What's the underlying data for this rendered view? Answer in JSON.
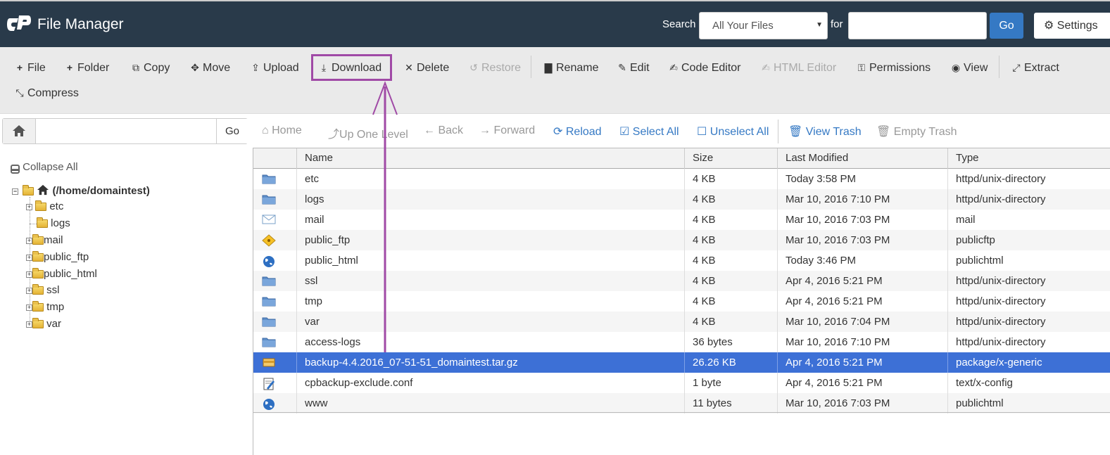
{
  "header": {
    "app_title": "File Manager",
    "search_label": "Search",
    "search_scope": "All Your Files",
    "for_label": "for",
    "search_value": "",
    "go_label": "Go",
    "settings_label": "Settings"
  },
  "toolbar": {
    "file": "File",
    "folder": "Folder",
    "copy": "Copy",
    "move": "Move",
    "upload": "Upload",
    "download": "Download",
    "delete": "Delete",
    "restore": "Restore",
    "rename": "Rename",
    "edit": "Edit",
    "code_editor": "Code Editor",
    "html_editor": "HTML Editor",
    "permissions": "Permissions",
    "view": "View",
    "extract": "Extract",
    "compress": "Compress"
  },
  "left": {
    "path_value": "",
    "go_label": "Go",
    "collapse_all": "Collapse All",
    "root": "(/home/domaintest)",
    "tree": [
      "etc",
      "logs",
      "mail",
      "public_ftp",
      "public_html",
      "ssl",
      "tmp",
      "var"
    ]
  },
  "navbar": {
    "home": "Home",
    "up_one_level": "Up One Level",
    "back": "Back",
    "forward": "Forward",
    "reload": "Reload",
    "select_all": "Select All",
    "unselect_all": "Unselect All",
    "view_trash": "View Trash",
    "empty_trash": "Empty Trash"
  },
  "table": {
    "columns": [
      "Name",
      "Size",
      "Last Modified",
      "Type"
    ],
    "rows": [
      {
        "icon": "folder-icon",
        "name": "etc",
        "size": "4 KB",
        "modified": "Today 3:58 PM",
        "type": "httpd/unix-directory"
      },
      {
        "icon": "folder-icon",
        "name": "logs",
        "size": "4 KB",
        "modified": "Mar 10, 2016 7:10 PM",
        "type": "httpd/unix-directory"
      },
      {
        "icon": "mail-icon",
        "name": "mail",
        "size": "4 KB",
        "modified": "Mar 10, 2016 7:03 PM",
        "type": "mail"
      },
      {
        "icon": "publicftp-icon",
        "name": "public_ftp",
        "size": "4 KB",
        "modified": "Mar 10, 2016 7:03 PM",
        "type": "publicftp"
      },
      {
        "icon": "globe-icon",
        "name": "public_html",
        "size": "4 KB",
        "modified": "Today 3:46 PM",
        "type": "publichtml"
      },
      {
        "icon": "folder-icon",
        "name": "ssl",
        "size": "4 KB",
        "modified": "Apr 4, 2016 5:21 PM",
        "type": "httpd/unix-directory"
      },
      {
        "icon": "folder-icon",
        "name": "tmp",
        "size": "4 KB",
        "modified": "Apr 4, 2016 5:21 PM",
        "type": "httpd/unix-directory"
      },
      {
        "icon": "folder-icon",
        "name": "var",
        "size": "4 KB",
        "modified": "Mar 10, 2016 7:04 PM",
        "type": "httpd/unix-directory"
      },
      {
        "icon": "folder-icon",
        "name": "access-logs",
        "size": "36 bytes",
        "modified": "Mar 10, 2016 7:10 PM",
        "type": "httpd/unix-directory"
      },
      {
        "icon": "package-icon",
        "name": "backup-4.4.2016_07-51-51_domaintest.tar.gz",
        "size": "26.26 KB",
        "modified": "Apr 4, 2016 5:21 PM",
        "type": "package/x-generic",
        "selected": true
      },
      {
        "icon": "config-icon",
        "name": "cpbackup-exclude.conf",
        "size": "1 byte",
        "modified": "Apr 4, 2016 5:21 PM",
        "type": "text/x-config"
      },
      {
        "icon": "globe-icon",
        "name": "www",
        "size": "11 bytes",
        "modified": "Mar 10, 2016 7:03 PM",
        "type": "publichtml"
      }
    ]
  },
  "colors": {
    "header_bg": "#293a4a",
    "accent": "#3579c4",
    "selected_row": "#3d70d6",
    "annotation": "#a04aa6"
  }
}
